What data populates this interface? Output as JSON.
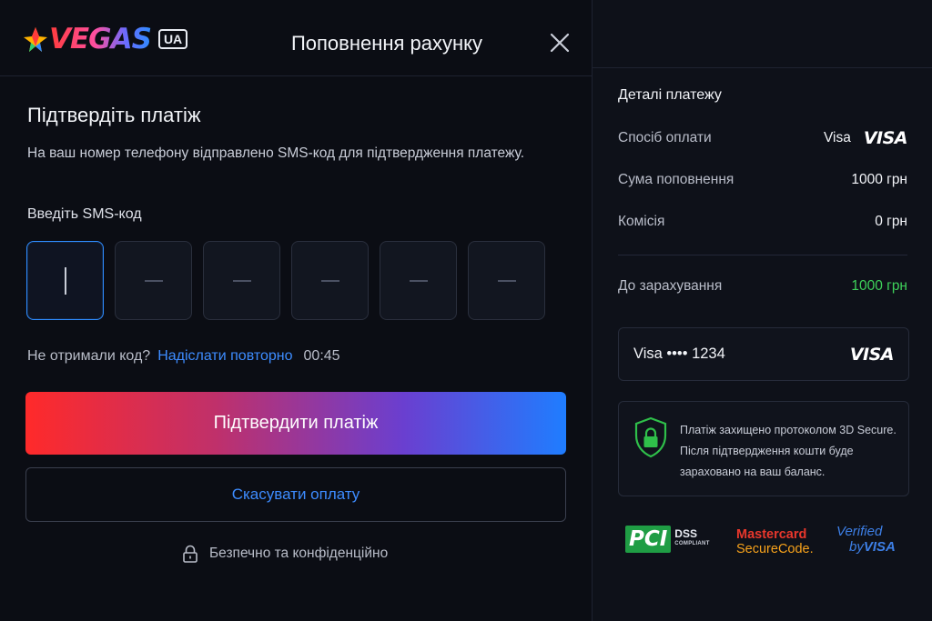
{
  "header": {
    "logo_text": "VEGAS",
    "logo_badge": "UA",
    "title": "Поповнення рахунку",
    "close_icon": "close-icon"
  },
  "confirm": {
    "title": "Підтвердіть платіж",
    "description": "На ваш номер телефону відправлено SMS-код для підтвердження платежу.",
    "sms_label": "Введіть SMS-код",
    "code_length": 6,
    "resend_question": "Не отримали код?",
    "resend_link": "Надіслати повторно",
    "timer": "00:45",
    "primary_button": "Підтвердити платіж",
    "secondary_button": "Скасувати оплату",
    "secure_note": "Безпечно та конфіденційно"
  },
  "details": {
    "title": "Деталі платежу",
    "method_label": "Спосіб оплати",
    "method_value": "Visa",
    "method_logo": "VISA",
    "amount_label": "Сума поповнення",
    "amount_value": "1000 грн",
    "fee_label": "Комісія",
    "fee_value": "0 грн",
    "credit_label": "До зарахування",
    "credit_value": "1000 грн",
    "card_label": "Visa •••• 1234",
    "card_logo": "VISA",
    "secure_text": "Платіж захищено протоколом 3D Secure. Після підтвердження кошти буде зараховано на ваш баланс."
  },
  "badges": {
    "pci": "PCI",
    "pci_dss": "DSS",
    "pci_compliant": "COMPLIANT",
    "mastercard_line1": "Mastercard",
    "mastercard_line2": "SecureCode.",
    "visa_line1": "Verified",
    "visa_line2_by": "by",
    "visa_line2_brand": "VISA"
  },
  "colors": {
    "accent": "#2f8cff",
    "link": "#3d8cff",
    "success": "#3ed15a",
    "gradient_start": "#ff2a2a",
    "gradient_end": "#1f7dff"
  }
}
